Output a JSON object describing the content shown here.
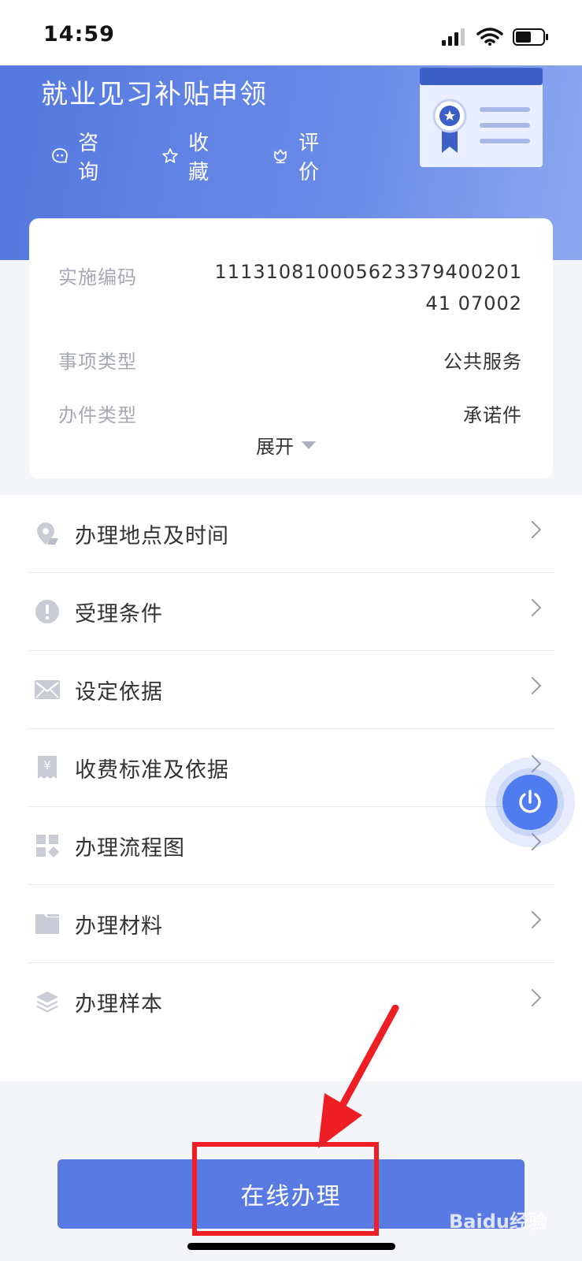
{
  "status": {
    "time": "14:59"
  },
  "header": {
    "title": "就业见习补贴申领",
    "actions": [
      {
        "label": "咨询",
        "icon": "chat-icon"
      },
      {
        "label": "收藏",
        "icon": "star-icon"
      },
      {
        "label": "评价",
        "icon": "flower-icon"
      }
    ]
  },
  "info": {
    "rows": [
      {
        "label": "实施编码",
        "value": "11131081000562337940020141 07002"
      },
      {
        "label": "事项类型",
        "value": "公共服务"
      },
      {
        "label": "办件类型",
        "value": "承诺件"
      }
    ],
    "expand_label": "展开"
  },
  "menu": {
    "items": [
      {
        "label": "办理地点及时间",
        "icon": "location-icon"
      },
      {
        "label": "受理条件",
        "icon": "exclamation-icon"
      },
      {
        "label": "设定依据",
        "icon": "envelope-icon"
      },
      {
        "label": "收费标准及依据",
        "icon": "yuan-receipt-icon"
      },
      {
        "label": "办理流程图",
        "icon": "flowchart-icon"
      },
      {
        "label": "办理材料",
        "icon": "folder-icon"
      },
      {
        "label": "办理样本",
        "icon": "layers-icon"
      }
    ]
  },
  "footer": {
    "button_label": "在线办理"
  },
  "watermark": "Baidu经验",
  "colors": {
    "accent": "#5a7ae3",
    "banner": "#6a8be8",
    "annotation": "#ee1f24"
  }
}
